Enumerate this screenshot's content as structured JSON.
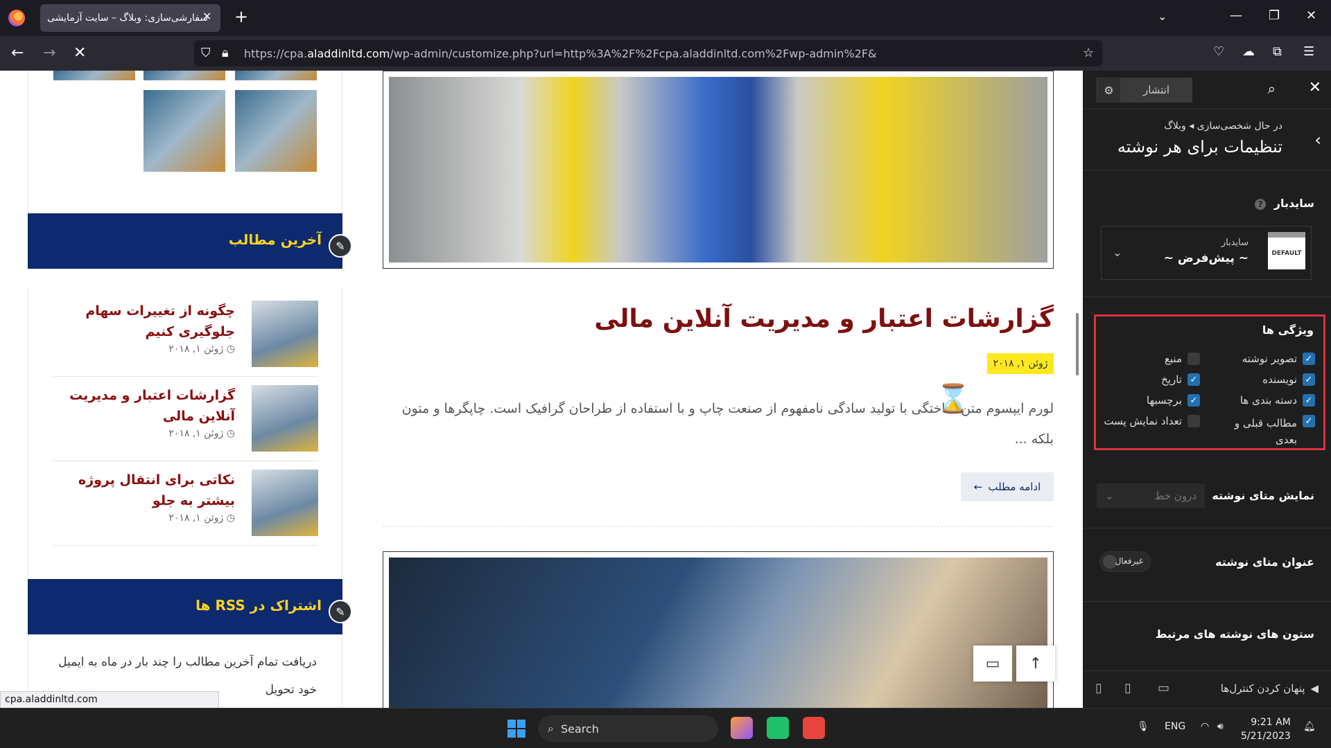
{
  "browser": {
    "tab_title": "سفارشی‌سازی: وبلاگ – سایت آزمایشی",
    "url_prefix": "https://cpa.",
    "url_domain": "aladdinltd.com",
    "url_path": "/wp-admin/customize.php?url=http%3A%2F%2Fcpa.aladdinltd.com%2Fwp-admin%2F&",
    "status_url": "cpa.aladdinltd.com"
  },
  "sidebar_widgets": {
    "recent_title": "آخرین مطالب",
    "recent_posts": [
      {
        "title": "چگونه از تغییرات سهام جلوگیری کنیم",
        "date": "ژوئن ۱, ۲۰۱۸"
      },
      {
        "title": "گزارشات اعتبار و مدیریت آنلاین مالی",
        "date": "ژوئن ۱, ۲۰۱۸"
      },
      {
        "title": "نکاتی برای انتقال پروژه بیشتر به جلو",
        "date": "ژوئن ۱, ۲۰۱۸"
      }
    ],
    "rss_title": "اشتراک در RSS ها",
    "rss_text": "دریافت تمام آخرین مطالب را چند بار در ماه به ایمیل خود تحویل"
  },
  "post": {
    "title": "گزارشات اعتبار و مدیریت آنلاین مالی",
    "date": "ژوئن ۱, ۲۰۱۸",
    "excerpt": "لورم ایپسوم متن ساختگی با تولید سادگی نامفهوم از صنعت چاپ و با استفاده از طراحان گرافیک است. چاپگرها و متون بلکه ...",
    "read_more": "ادامه مطلب"
  },
  "customizer": {
    "publish": "انتشار",
    "breadcrumb_prefix": "در حال شخصی‌سازی",
    "breadcrumb_section": "وبلاگ",
    "panel_title": "تنظیمات برای هر نوشته",
    "sidebar_label": "سایدبار",
    "sidebar_small": "سایدبار",
    "sidebar_value": "~ پیش‌فرض ~",
    "default_badge": "DEFAULT",
    "features_title": "ویژگی ها",
    "features": [
      {
        "label": "تصویر نوشته",
        "checked": true
      },
      {
        "label": "منبع",
        "checked": false
      },
      {
        "label": "نویسنده",
        "checked": true
      },
      {
        "label": "تاریخ",
        "checked": true
      },
      {
        "label": "دسته بندی ها",
        "checked": true
      },
      {
        "label": "برچسبها",
        "checked": true
      },
      {
        "label": "مطالب قبلی و بعدی",
        "checked": true
      },
      {
        "label": "تعداد نمایش پست",
        "checked": false
      }
    ],
    "meta_display_label": "نمایش متای نوشته",
    "meta_display_value": "درون خط",
    "meta_title_label": "عنوان متای نوشته",
    "meta_title_toggle": "غیرفعال",
    "related_cols_label": "ستون های نوشته های مرتبط",
    "hide_controls": "پنهان کردن کنترل‌ها"
  },
  "taskbar": {
    "search": "Search",
    "lang": "ENG",
    "time": "9:21 AM",
    "date": "5/21/2023"
  },
  "colors": {
    "widget_header": "#0d2a6e",
    "widget_title": "#ffd21f",
    "post_title": "#7d0f0f",
    "highlight_box": "#e0303a",
    "checkbox_on": "#2271b1"
  }
}
